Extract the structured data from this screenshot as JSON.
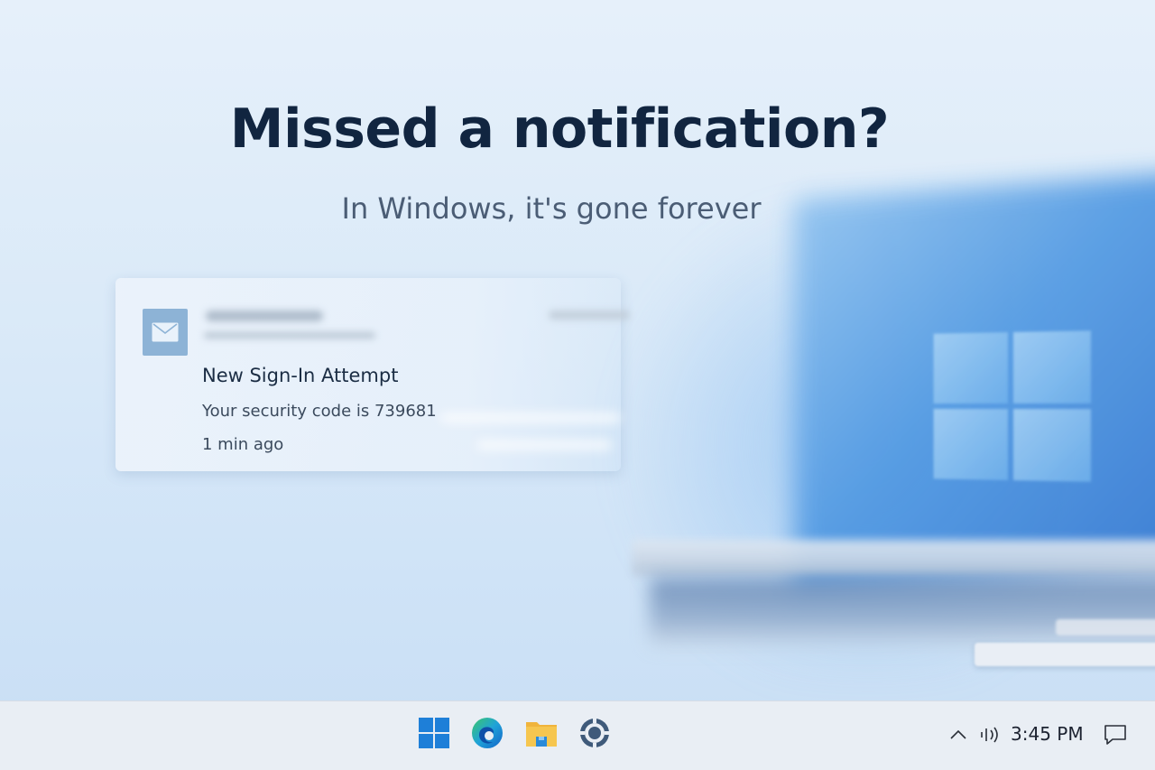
{
  "hero": {
    "title": "Missed a notification?",
    "subtitle": "In Windows, it's gone forever"
  },
  "notification": {
    "app_icon": "mail-icon",
    "title": "New Sign-In Attempt",
    "body": "Your security code is 739681",
    "time": "1 min ago"
  },
  "taskbar": {
    "apps": [
      {
        "name": "start-button",
        "icon": "windows-logo-icon"
      },
      {
        "name": "edge-button",
        "icon": "edge-icon"
      },
      {
        "name": "file-explorer-button",
        "icon": "folder-icon"
      },
      {
        "name": "settings-button",
        "icon": "settings-icon"
      }
    ],
    "tray": {
      "chevron_icon": "chevron-up-icon",
      "audio_icon": "speaker-icon",
      "time": "3:45 PM",
      "notification_icon": "chat-bubble-icon"
    }
  },
  "colors": {
    "accent": "#1e7fd8",
    "title_text": "#112540",
    "subtitle_text": "#4b5d75",
    "taskbar_bg": "#e9eef4"
  }
}
